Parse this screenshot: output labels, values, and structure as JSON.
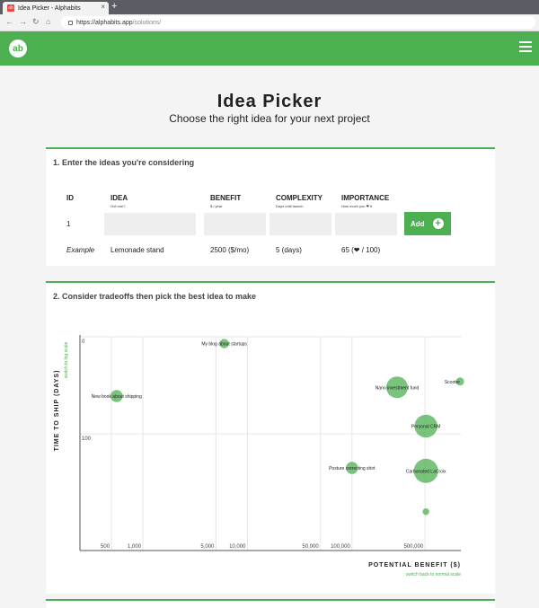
{
  "browser": {
    "tab_title": "Idea Picker - Alphabits",
    "favicon": "ab",
    "tab_close": "×",
    "new_tab": "+",
    "url_host": "https://alphabits.app",
    "url_path": "/solutions/",
    "nav": {
      "back": "←",
      "forward": "→",
      "reload": "↻",
      "home": "⌂"
    }
  },
  "site": {
    "logo": "ab",
    "brand_color": "#4caf50"
  },
  "page": {
    "title": "Idea Picker",
    "subtitle": "Choose the right idea for your next project"
  },
  "step1": {
    "title": "1. Enter the ideas you're considering",
    "columns": [
      {
        "label": "ID",
        "sub": ""
      },
      {
        "label": "IDEA",
        "sub": "Got one?"
      },
      {
        "label": "BENEFIT",
        "sub": "$ / year"
      },
      {
        "label": "COMPLEXITY",
        "sub": "Days until launch"
      },
      {
        "label": "IMPORTANCE",
        "sub": "How much you ❤ it"
      }
    ],
    "row_id": "1",
    "inputs": {
      "idea": "",
      "benefit": "",
      "complexity": "",
      "importance": ""
    },
    "add_label": "Add",
    "add_icon": "+",
    "example": {
      "id": "Example",
      "idea": "Lemonade stand",
      "benefit": "2500 ($/mo)",
      "complexity": "5 (days)",
      "importance": "65 (❤ / 100)"
    }
  },
  "step2": {
    "title": "2. Consider tradeoffs then pick the best idea to make",
    "y_axis_label": "TIME TO SHIP (DAYS)",
    "y_switch": "switch to log scale",
    "x_axis_label": "POTENTIAL BENEFIT ($)",
    "x_switch": "switch back to normal scale"
  },
  "chart_data": {
    "type": "scatter",
    "xlabel": "POTENTIAL BENEFIT ($)",
    "ylabel": "TIME TO SHIP (DAYS)",
    "x_scale": "log",
    "y_scale": "linear",
    "x_ticks": [
      "500",
      "1,000",
      "5,000",
      "10,000",
      "50,000",
      "100,000",
      "500,000"
    ],
    "y_ticks": [
      "0",
      "100"
    ],
    "xlim": [
      250,
      1100000
    ],
    "ylim": [
      0,
      220
    ],
    "grid": true,
    "points": [
      {
        "name": "My blog about startups",
        "x": 6000,
        "y": 7,
        "importance": 15
      },
      {
        "name": "New book about shipping",
        "x": 560,
        "y": 61,
        "importance": 25
      },
      {
        "name": "Nano investment fund",
        "x": 270000,
        "y": 52,
        "importance": 60
      },
      {
        "name": "Scooter",
        "x": 1080000,
        "y": 46,
        "importance": 10
      },
      {
        "name": "Personal CRM",
        "x": 510000,
        "y": 92,
        "importance": 65
      },
      {
        "name": "Posture correcting shirt",
        "x": 100000,
        "y": 135,
        "importance": 25
      },
      {
        "name": "Carbonated LaCroix",
        "x": 510000,
        "y": 138,
        "importance": 70
      },
      {
        "name": "",
        "x": 510000,
        "y": 180,
        "importance": 5
      }
    ]
  }
}
